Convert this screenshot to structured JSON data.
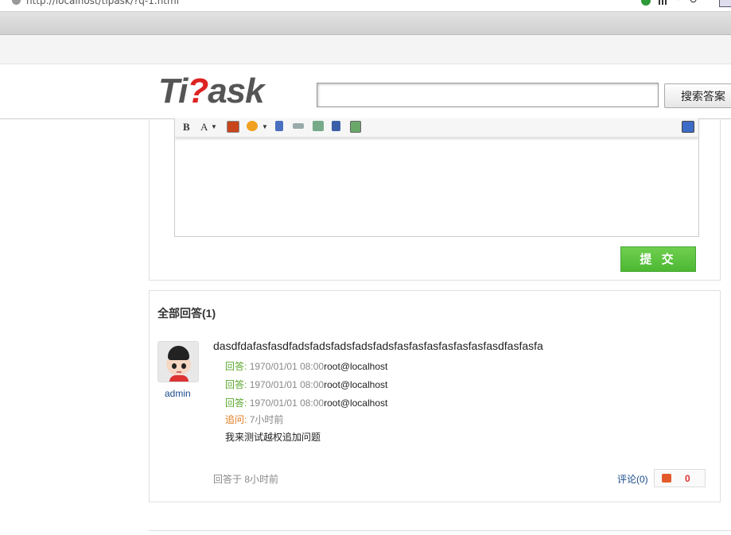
{
  "browser": {
    "url": "http://localhost/tipask/?q-1.html"
  },
  "header": {
    "logo": {
      "part1": "Ti",
      "part2": "?",
      "part3": "ask"
    },
    "search": {
      "placeholder": "",
      "button_label": "搜索答案"
    }
  },
  "editor": {
    "toolbar": {
      "bold": "B",
      "font": "A"
    },
    "submit_label": "提 交"
  },
  "answers": {
    "title": "全部回答(1)",
    "items": [
      {
        "user": "admin",
        "text": "dasdfdafasfasdfadsfadsfadsfadsfadsfasfasfasfasfasfasfasdfasfasfa",
        "replies": [
          {
            "label": "回答:",
            "time": "1970/01/01 08:00",
            "user": "root@localhost"
          },
          {
            "label": "回答:",
            "time": "1970/01/01 08:00",
            "user": "root@localhost"
          },
          {
            "label": "回答:",
            "time": "1970/01/01 08:00",
            "user": "root@localhost"
          }
        ],
        "followup": {
          "label": "追问:",
          "time": "7小时前",
          "text": "我来测试越权追加问题"
        },
        "answered_at": "回答于 8小时前",
        "comment_label": "评论(0)",
        "votes": "0"
      }
    ]
  },
  "colors": {
    "submit_green": "#5cc23f",
    "logo_red": "#dd2222",
    "reply_green": "#5aa82c",
    "followup_orange": "#e07a1e",
    "link_blue": "#1a4a8a"
  },
  "icons": [
    "globe-icon",
    "shield-icon",
    "qr-icon",
    "reload-icon",
    "extension-icon",
    "image-icon",
    "magic-icon",
    "attachment-icon",
    "link-icon",
    "code-icon",
    "video-icon",
    "gallery-icon",
    "fullscreen-icon",
    "thumb-up-icon"
  ]
}
